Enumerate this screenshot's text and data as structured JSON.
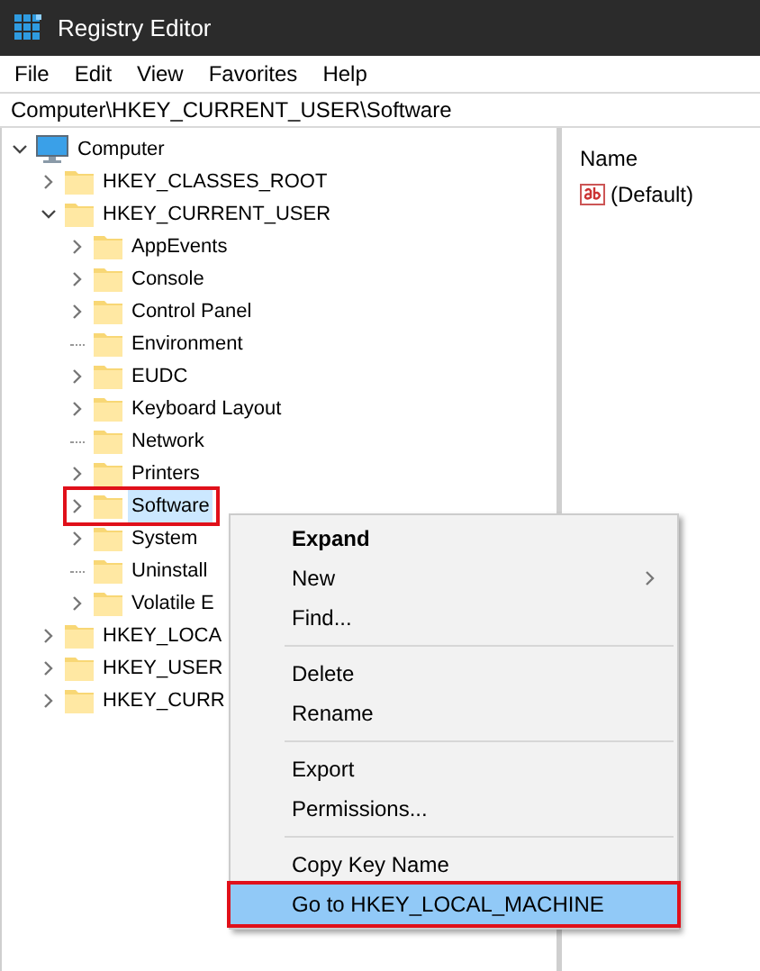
{
  "window": {
    "title": "Registry Editor"
  },
  "menu_bar": [
    "File",
    "Edit",
    "View",
    "Favorites",
    "Help"
  ],
  "address_bar": {
    "value": "Computer\\HKEY_CURRENT_USER\\Software"
  },
  "tree": [
    {
      "label": "Computer",
      "kind": "computer",
      "expandable": true,
      "expanded": true,
      "selected": false,
      "annotated": false,
      "children": [
        {
          "label": "HKEY_CLASSES_ROOT",
          "kind": "folder",
          "expandable": true,
          "expanded": false,
          "selected": false,
          "annotated": false
        },
        {
          "label": "HKEY_CURRENT_USER",
          "kind": "folder",
          "expandable": true,
          "expanded": true,
          "selected": false,
          "annotated": false,
          "children": [
            {
              "label": "AppEvents",
              "kind": "folder",
              "expandable": true,
              "expanded": false,
              "selected": false,
              "annotated": false
            },
            {
              "label": "Console",
              "kind": "folder",
              "expandable": true,
              "expanded": false,
              "selected": false,
              "annotated": false
            },
            {
              "label": "Control Panel",
              "kind": "folder",
              "expandable": true,
              "expanded": false,
              "selected": false,
              "annotated": false
            },
            {
              "label": "Environment",
              "kind": "folder",
              "expandable": false,
              "expanded": false,
              "selected": false,
              "annotated": false
            },
            {
              "label": "EUDC",
              "kind": "folder",
              "expandable": true,
              "expanded": false,
              "selected": false,
              "annotated": false
            },
            {
              "label": "Keyboard Layout",
              "kind": "folder",
              "expandable": true,
              "expanded": false,
              "selected": false,
              "annotated": false
            },
            {
              "label": "Network",
              "kind": "folder",
              "expandable": false,
              "expanded": false,
              "selected": false,
              "annotated": false
            },
            {
              "label": "Printers",
              "kind": "folder",
              "expandable": true,
              "expanded": false,
              "selected": false,
              "annotated": false
            },
            {
              "label": "Software",
              "kind": "folder",
              "expandable": true,
              "expanded": false,
              "selected": true,
              "annotated": true
            },
            {
              "label": "System",
              "kind": "folder",
              "expandable": true,
              "expanded": false,
              "selected": false,
              "annotated": false
            },
            {
              "label": "Uninstall",
              "kind": "folder",
              "expandable": false,
              "expanded": false,
              "selected": false,
              "annotated": false
            },
            {
              "label": "Volatile E",
              "kind": "folder",
              "expandable": true,
              "expanded": false,
              "selected": false,
              "annotated": false
            }
          ]
        },
        {
          "label": "HKEY_LOCA",
          "kind": "folder",
          "expandable": true,
          "expanded": false,
          "selected": false,
          "annotated": false
        },
        {
          "label": "HKEY_USER",
          "kind": "folder",
          "expandable": true,
          "expanded": false,
          "selected": false,
          "annotated": false
        },
        {
          "label": "HKEY_CURR",
          "kind": "folder",
          "expandable": true,
          "expanded": false,
          "selected": false,
          "annotated": false
        }
      ]
    }
  ],
  "values_pane": {
    "columns": [
      "Name"
    ],
    "rows": [
      {
        "name": "(Default)"
      }
    ]
  },
  "context_menu": {
    "items": [
      {
        "kind": "item",
        "label": "Expand",
        "default": true,
        "submenu": false,
        "selected": false,
        "annotated": false
      },
      {
        "kind": "item",
        "label": "New",
        "default": false,
        "submenu": true,
        "selected": false,
        "annotated": false
      },
      {
        "kind": "item",
        "label": "Find...",
        "default": false,
        "submenu": false,
        "selected": false,
        "annotated": false
      },
      {
        "kind": "separator"
      },
      {
        "kind": "item",
        "label": "Delete",
        "default": false,
        "submenu": false,
        "selected": false,
        "annotated": false
      },
      {
        "kind": "item",
        "label": "Rename",
        "default": false,
        "submenu": false,
        "selected": false,
        "annotated": false
      },
      {
        "kind": "separator"
      },
      {
        "kind": "item",
        "label": "Export",
        "default": false,
        "submenu": false,
        "selected": false,
        "annotated": false
      },
      {
        "kind": "item",
        "label": "Permissions...",
        "default": false,
        "submenu": false,
        "selected": false,
        "annotated": false
      },
      {
        "kind": "separator"
      },
      {
        "kind": "item",
        "label": "Copy Key Name",
        "default": false,
        "submenu": false,
        "selected": false,
        "annotated": false
      },
      {
        "kind": "item",
        "label": "Go to HKEY_LOCAL_MACHINE",
        "default": false,
        "submenu": false,
        "selected": true,
        "annotated": true
      }
    ]
  }
}
